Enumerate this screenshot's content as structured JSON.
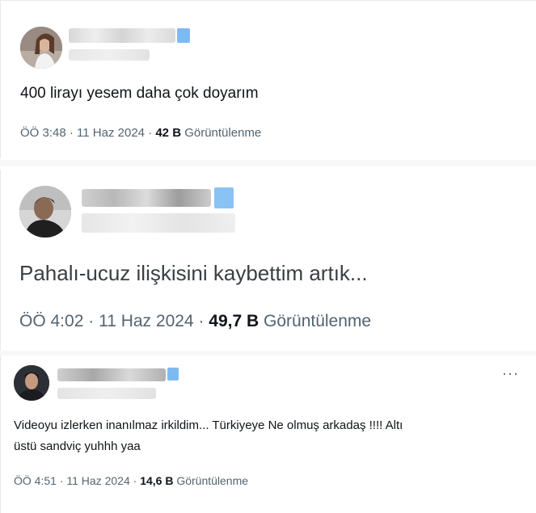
{
  "tweets": [
    {
      "text": "400 lirayı yesem daha çok doyarım",
      "time": "ÖÖ 3:48",
      "sep1": "·",
      "date": "11 Haz 2024",
      "sep2": "·",
      "views": "42 B",
      "views_label": "Görüntülenme",
      "avatar_icon": "woman-avatar-icon",
      "colors": {
        "avatar_bg": "#6b5a52",
        "badge": "#6fb3f0"
      }
    },
    {
      "text": "Pahalı-ucuz ilişkisini kaybettim artık...",
      "time": "ÖÖ 4:02",
      "sep1": "·",
      "date": "11 Haz 2024",
      "sep2": "·",
      "views": "49,7 B",
      "views_label": "Görüntülenme",
      "avatar_icon": "man-avatar-icon",
      "colors": {
        "avatar_bg": "#4a4a4a",
        "badge": "#6fb3f0"
      }
    },
    {
      "text_line1": "Videoyu izlerken inanılmaz irkildim... Türkiyeye Ne olmuş arkadaş !!!! Altı",
      "text_line2": "üstü sandviç yuhhh yaa",
      "time": "ÖÖ 4:51",
      "sep1": "·",
      "date": "11 Haz 2024",
      "sep2": "·",
      "views": "14,6 B",
      "views_label": "Görüntülenme",
      "more": "···",
      "avatar_icon": "man-avatar-icon",
      "colors": {
        "avatar_bg": "#3a3f45",
        "badge": "#6fb3f0"
      }
    }
  ]
}
